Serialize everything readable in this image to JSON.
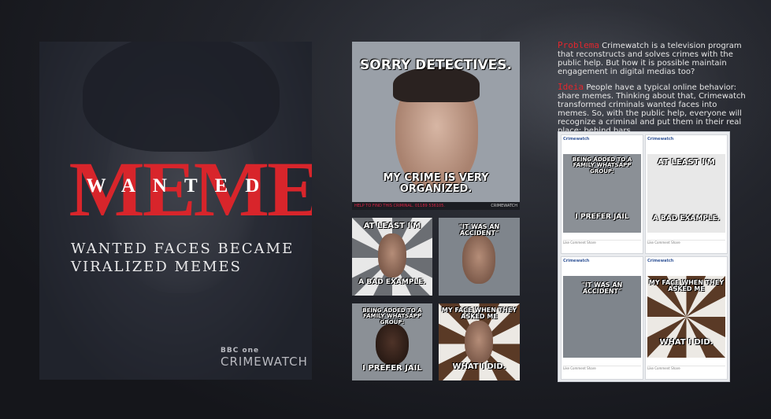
{
  "poster": {
    "meme_word": "MEME",
    "wanted_word": "WANTED",
    "tagline_line1": "WANTED FACES BECAME",
    "tagline_line2": "VIRALIZED MEMES",
    "brand_one": "BBC one",
    "brand_crimewatch": "CRIMEWATCH"
  },
  "hero_meme": {
    "top": "SORRY DETECTIVES.",
    "bottom": "MY CRIME IS VERY ORGANIZED.",
    "strip_left": "HELP TO FIND THIS CRIMINAL. 01189 536105.",
    "strip_brand": "CRIMEWATCH"
  },
  "tiles": [
    {
      "top": "AT LEAST I'M",
      "bottom": "A BAD EXAMPLE."
    },
    {
      "top": "\"IT WAS AN ACCIDENT\"",
      "bottom": ""
    },
    {
      "top": "BEING ADDED TO A FAMILY WHATSAPP GROUP:",
      "bottom": "I PREFER JAIL"
    },
    {
      "top": "MY FACE WHEN THEY ASKED ME",
      "bottom": "WHAT I DID."
    }
  ],
  "copy": {
    "problem_label": "Problema",
    "problem_text": "Crimewatch is a television program that reconstructs and solves crimes with the public help. But how it is possible maintain engagement in digital medias too?",
    "idea_label": "Ideia",
    "idea_text": "People have a typical online behavior: share memes. Thinking about that, Crimewatch transformed criminals wanted faces into memes. So, with the public help, everyone will recognize a criminal and put them in their real place: behind bars."
  },
  "facebook": {
    "page_name": "Crimewatch",
    "posts": [
      {
        "top": "BEING ADDED TO A FAMILY WHATSAPP GROUP:",
        "bottom": "I PREFER JAIL"
      },
      {
        "top": "AT LEAST I'M",
        "bottom": "A BAD EXAMPLE."
      },
      {
        "top": "\"IT WAS AN ACCIDENT\"",
        "bottom": ""
      },
      {
        "top": "MY FACE WHEN THEY ASKED ME",
        "bottom": "WHAT I DID."
      }
    ],
    "actions": "Like   Comment   Share"
  },
  "colors": {
    "accent_red": "#d8252b",
    "background": "#1a1c22"
  }
}
